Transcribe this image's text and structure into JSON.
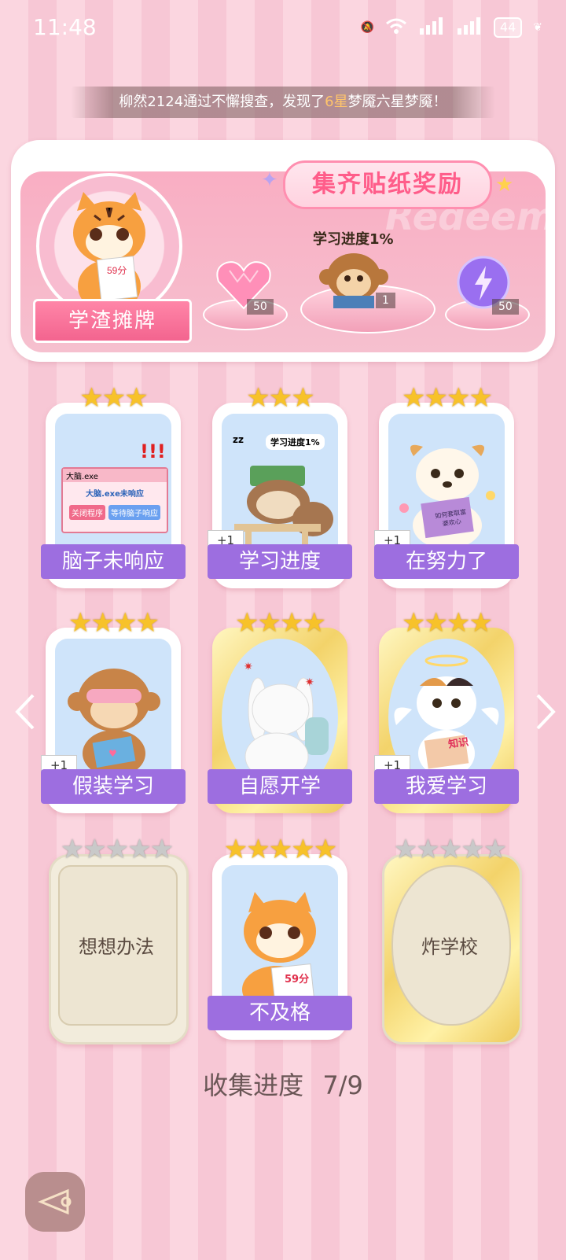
{
  "status_bar": {
    "time": "11:48",
    "battery": "44"
  },
  "notice": {
    "prefix": "柳然2124通过不懈搜查，发现了",
    "highlight": "6星",
    "suffix": "梦魇六星梦魇！"
  },
  "reward": {
    "title": "集齐贴纸奖励",
    "watermark": "Redeem",
    "avatar_label": "学渣摊牌",
    "progress_text": "学习进度1%",
    "items": [
      {
        "icon": "pink-heart-gem-icon",
        "count": "50"
      },
      {
        "icon": "monkey-reading-icon",
        "count": "1"
      },
      {
        "icon": "purple-orb-icon",
        "count": "50"
      }
    ]
  },
  "stickers": [
    {
      "name": "脑子未响应",
      "stars": "★★★",
      "plus": "",
      "locked": false
    },
    {
      "name": "学习进度",
      "stars": "★★★",
      "plus": "+1",
      "locked": false
    },
    {
      "name": "在努力了",
      "stars": "★★★★",
      "plus": "+1",
      "locked": false
    },
    {
      "name": "假装学习",
      "stars": "★★★★",
      "plus": "+1",
      "locked": false
    },
    {
      "name": "自愿开学",
      "stars": "★★★★",
      "plus": "",
      "locked": false
    },
    {
      "name": "我爱学习",
      "stars": "★★★★",
      "plus": "+1",
      "locked": false
    },
    {
      "name": "想想办法",
      "stars": "★★★★★",
      "plus": "",
      "locked": true
    },
    {
      "name": "不及格",
      "stars": "★★★★★",
      "plus": "",
      "locked": false
    },
    {
      "name": "炸学校",
      "stars": "★★★★★",
      "plus": "",
      "locked": true
    }
  ],
  "sticker_art": {
    "s1": {
      "window_title": "大脑.exe",
      "message": "大脑.exe未响应",
      "btn_close": "关闭程序",
      "btn_wait": "等待脑子响应"
    },
    "s2": {
      "banner": "学习进度1%"
    },
    "s3": {
      "book": "如何套取富婆欢心"
    },
    "s6": {
      "book": "知识"
    },
    "s8": {
      "paper": "59分"
    }
  },
  "avatar_paper": "59分",
  "collection": {
    "label": "收集进度",
    "value": "7/9"
  },
  "colors": {
    "label_purple": "#9d6ee0",
    "star_gold": "#f7c22a",
    "accent_pink": "#ff5d8a"
  }
}
